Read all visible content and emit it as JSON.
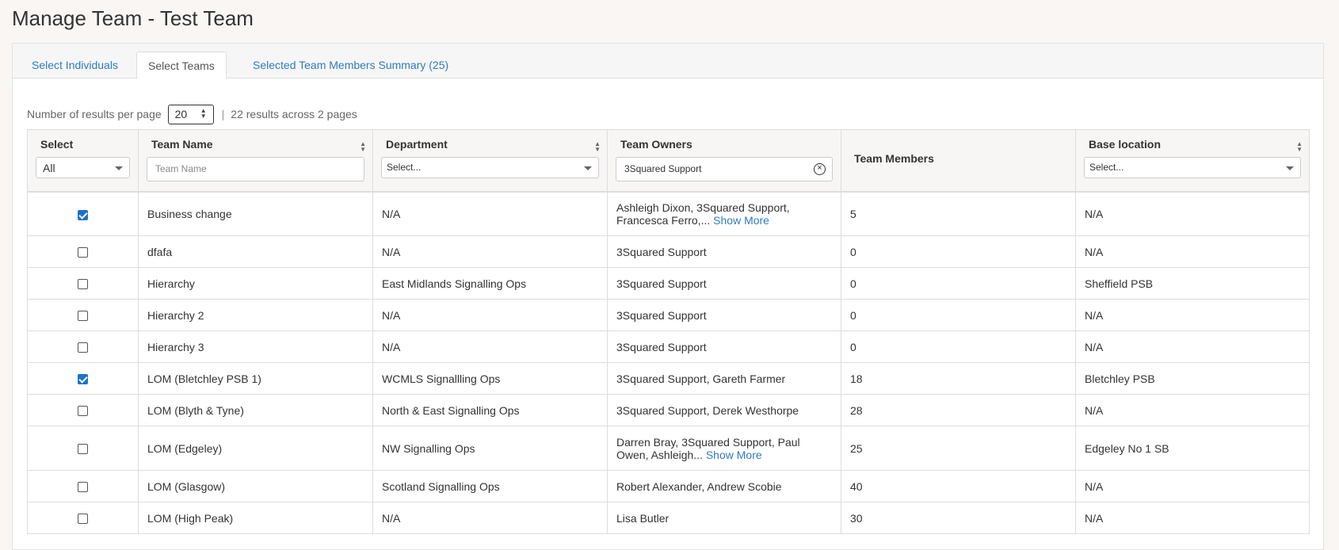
{
  "page_title": "Manage Team - Test Team",
  "tabs": [
    {
      "label": "Select Individuals",
      "active": false
    },
    {
      "label": "Select Teams",
      "active": true
    },
    {
      "label": "Selected Team Members Summary (25)",
      "active": false
    }
  ],
  "pagination": {
    "per_page_label": "Number of results per page",
    "per_page_value": "20",
    "results_text": "22 results across 2 pages"
  },
  "columns": {
    "select": {
      "label": "Select",
      "filter_value": "All"
    },
    "team_name": {
      "label": "Team Name",
      "filter_placeholder": "Team Name"
    },
    "department": {
      "label": "Department",
      "filter_value": "Select..."
    },
    "team_owners": {
      "label": "Team Owners",
      "filter_value": "3Squared Support"
    },
    "team_members": {
      "label": "Team Members"
    },
    "base_location": {
      "label": "Base location",
      "filter_value": "Select..."
    }
  },
  "show_more_label": "Show More",
  "rows": [
    {
      "checked": true,
      "team_name": "Business change",
      "department": "N/A",
      "owners": "Ashleigh Dixon, 3Squared Support, Francesca Ferro,...",
      "show_more": true,
      "members": "5",
      "location": "N/A"
    },
    {
      "checked": false,
      "team_name": "dfafa",
      "department": "N/A",
      "owners": "3Squared Support",
      "show_more": false,
      "members": "0",
      "location": "N/A"
    },
    {
      "checked": false,
      "team_name": "Hierarchy",
      "department": "East Midlands Signalling Ops",
      "owners": "3Squared Support",
      "show_more": false,
      "members": "0",
      "location": "Sheffield PSB"
    },
    {
      "checked": false,
      "team_name": "Hierarchy 2",
      "department": "N/A",
      "owners": "3Squared Support",
      "show_more": false,
      "members": "0",
      "location": "N/A"
    },
    {
      "checked": false,
      "team_name": "Hierarchy 3",
      "department": "N/A",
      "owners": "3Squared Support",
      "show_more": false,
      "members": "0",
      "location": "N/A"
    },
    {
      "checked": true,
      "team_name": "LOM (Bletchley PSB 1)",
      "department": "WCMLS Signallling Ops",
      "owners": "3Squared Support, Gareth Farmer",
      "show_more": false,
      "members": "18",
      "location": "Bletchley PSB"
    },
    {
      "checked": false,
      "team_name": "LOM (Blyth & Tyne)",
      "department": "North & East Signalling Ops",
      "owners": "3Squared Support, Derek Westhorpe",
      "show_more": false,
      "members": "28",
      "location": "N/A"
    },
    {
      "checked": false,
      "team_name": "LOM (Edgeley)",
      "department": "NW Signalling Ops",
      "owners": "Darren Bray, 3Squared Support, Paul Owen, Ashleigh...",
      "show_more": true,
      "members": "25",
      "location": "Edgeley No 1 SB"
    },
    {
      "checked": false,
      "team_name": "LOM (Glasgow)",
      "department": "Scotland Signalling Ops",
      "owners": "Robert Alexander, Andrew Scobie",
      "show_more": false,
      "members": "40",
      "location": "N/A"
    },
    {
      "checked": false,
      "team_name": "LOM (High Peak)",
      "department": "N/A",
      "owners": "Lisa Butler",
      "show_more": false,
      "members": "30",
      "location": "N/A"
    }
  ]
}
